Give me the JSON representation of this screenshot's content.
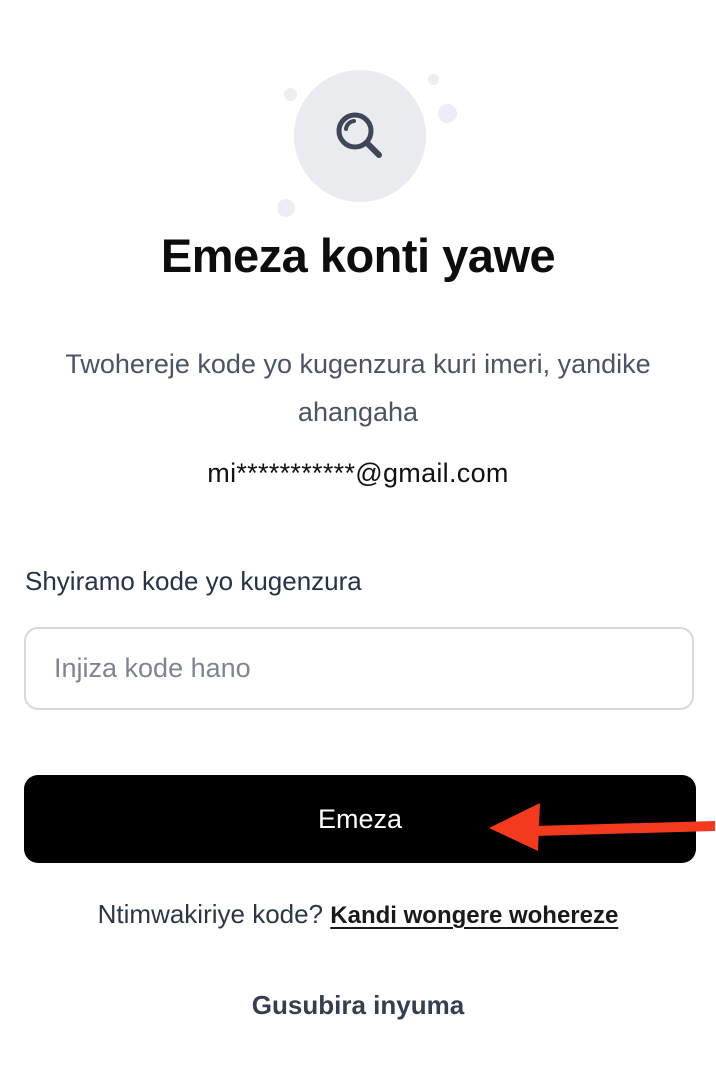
{
  "hero": {
    "icon": "search-icon",
    "circle_color": "#e9ebef",
    "icon_color": "#3e4758"
  },
  "title": "Emeza konti yawe",
  "description": "Twohereje kode yo kugenzura kuri imeri, yandike ahangaha",
  "email": "mi***********@gmail.com",
  "code_field": {
    "label": "Shyiramo kode yo kugenzura",
    "placeholder": "Injiza kode hano",
    "value": ""
  },
  "confirm_button": {
    "label": "Emeza",
    "background": "#000000",
    "text_color": "#ffffff"
  },
  "annotation": {
    "icon": "arrow-left-icon",
    "color": "#f33a1f"
  },
  "resend": {
    "prompt": "Ntimwakiriye kode?",
    "link_label": "Kandi wongere wohereze"
  },
  "back_link": "Gusubira inyuma"
}
